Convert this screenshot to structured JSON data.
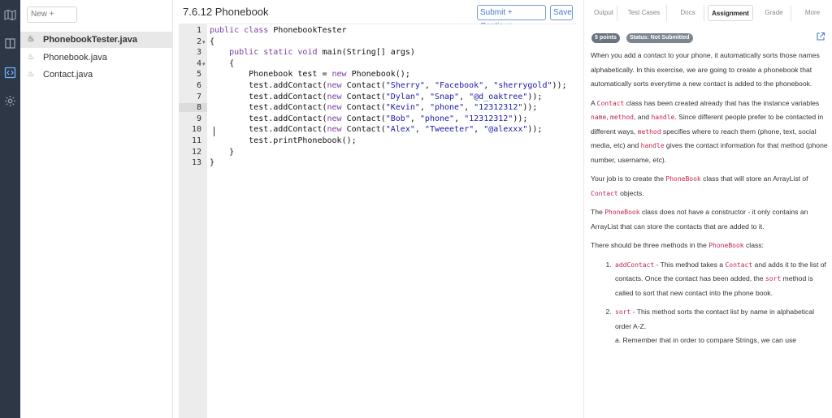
{
  "rail": {
    "icons": [
      "map-icon",
      "book-icon",
      "code-icon",
      "gear-icon"
    ]
  },
  "files": {
    "new_label": "New +",
    "items": [
      {
        "name": "PhonebookTester.java",
        "active": true
      },
      {
        "name": "Phonebook.java",
        "active": false
      },
      {
        "name": "Contact.java",
        "active": false
      }
    ]
  },
  "editor": {
    "title": "7.6.12 Phonebook",
    "submit_label": "Submit + Continue",
    "save_label": "Save",
    "lines": [
      {
        "n": "1",
        "fold": false,
        "html": "<span class=\"kw\">public</span> <span class=\"kw\">class</span> PhonebookTester"
      },
      {
        "n": "2",
        "fold": true,
        "html": "{"
      },
      {
        "n": "3",
        "fold": false,
        "html": "    <span class=\"kw\">public</span> <span class=\"kw\">static</span> <span class=\"kw\">void</span> main(String[] args)"
      },
      {
        "n": "4",
        "fold": true,
        "html": "    {"
      },
      {
        "n": "5",
        "fold": false,
        "html": "        Phonebook test = <span class=\"kw\">new</span> Phonebook();"
      },
      {
        "n": "6",
        "fold": false,
        "html": "        test.addContact(<span class=\"kw\">new</span> Contact(<span class=\"str\">\"Sherry\"</span>, <span class=\"str\">\"Facebook\"</span>, <span class=\"str\">\"sherrygold\"</span>));"
      },
      {
        "n": "7",
        "fold": false,
        "html": "        test.addContact(<span class=\"kw\">new</span> Contact(<span class=\"str\">\"Dylan\"</span>, <span class=\"str\">\"Snap\"</span>, <span class=\"str\">\"@d_oaktree\"</span>));"
      },
      {
        "n": "8",
        "fold": false,
        "html": "        test.addContact(<span class=\"kw\">new</span> Contact(<span class=\"str\">\"Kevin\"</span>, <span class=\"str\">\"phone\"</span>, <span class=\"str\">\"12312312\"</span>));"
      },
      {
        "n": "9",
        "fold": false,
        "html": "        test.addContact(<span class=\"kw\">new</span> Contact(<span class=\"str\">\"Bob\"</span>, <span class=\"str\">\"phone\"</span>, <span class=\"str\">\"12312312\"</span>));"
      },
      {
        "n": "10",
        "fold": false,
        "html": "        test.addContact(<span class=\"kw\">new</span> Contact(<span class=\"str\">\"Alex\"</span>, <span class=\"str\">\"Tweeeter\"</span>, <span class=\"str\">\"@alexxx\"</span>));"
      },
      {
        "n": "11",
        "fold": false,
        "html": "        test.printPhonebook();"
      },
      {
        "n": "12",
        "fold": false,
        "html": "    }"
      },
      {
        "n": "13",
        "fold": false,
        "html": "}"
      }
    ],
    "highlight_line": "8"
  },
  "tabs": [
    {
      "label": "Output"
    },
    {
      "label": "Test Cases"
    },
    {
      "label": "Docs"
    },
    {
      "label": "Assignment",
      "active": true
    },
    {
      "label": "Grade"
    },
    {
      "label": "More"
    }
  ],
  "assignment": {
    "points_badge": "5 points",
    "status_badge": "Status: Not Submitted",
    "p1": "When you add a contact to your phone, it automatically sorts those names alphabetically. In this exercise, we are going to create a phonebook that automatically sorts everytime a new contact is added to the phonebook.",
    "p2_a": "A ",
    "p2_code1": "Contact",
    "p2_b": " class has been created already that has the instance variables ",
    "p2_code2": "name",
    "p2_c": ", ",
    "p2_code3": "method",
    "p2_d": ", and ",
    "p2_code4": "handle",
    "p2_e": ". Since different people prefer to be contacted in different ways, ",
    "p2_code5": "method",
    "p2_f": " specifies where to reach them (phone, text, social media, etc) and ",
    "p2_code6": "handle",
    "p2_g": " gives the contact information for that method (phone number, username, etc).",
    "p3_a": "Your job is to create the ",
    "p3_code1": "PhoneBook",
    "p3_b": " class that will store an ArrayList of ",
    "p3_code2": "Contact",
    "p3_c": " objects.",
    "p4_a": "The ",
    "p4_code1": "PhoneBook",
    "p4_b": " class does not have a constructor - it only contains an ArrayList that can store the contacts that are added to it.",
    "p5_a": "There should be three methods in the ",
    "p5_code1": "PhoneBook",
    "p5_b": " class:",
    "li1_code1": "addContact",
    "li1_a": " - This method takes a ",
    "li1_code2": "Contact",
    "li1_b": " and adds it to the list of contacts. Once the contact has been added, the ",
    "li1_code3": "sort",
    "li1_c": " method is called to sort that new contact into the phone book.",
    "li2_code1": "sort",
    "li2_a": " - This method sorts the contact list by name in alphabetical order A-Z.",
    "li2_sub": "a. Remember that in order to compare Strings, we can use"
  }
}
